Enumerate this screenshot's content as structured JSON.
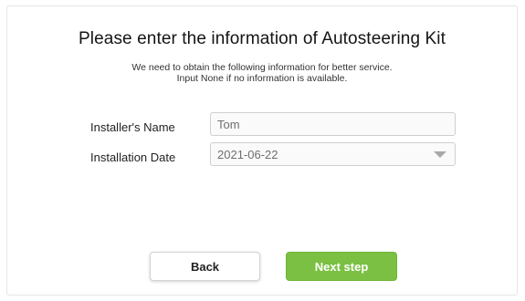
{
  "page": {
    "title": "Please enter the information of Autosteering Kit",
    "subtitle_line1": "We need to obtain the following information for better service.",
    "subtitle_line2": "Input None if no information is available."
  },
  "form": {
    "installer_name": {
      "label": "Installer's Name",
      "value": "Tom"
    },
    "installation_date": {
      "label": "Installation Date",
      "value": "2021-06-22",
      "icon": "chevron-down-icon"
    }
  },
  "actions": {
    "back_label": "Back",
    "next_label": "Next step"
  },
  "colors": {
    "accent_green": "#7bc043",
    "field_border": "#cfcfcf",
    "caret": "#a8a8a8"
  }
}
